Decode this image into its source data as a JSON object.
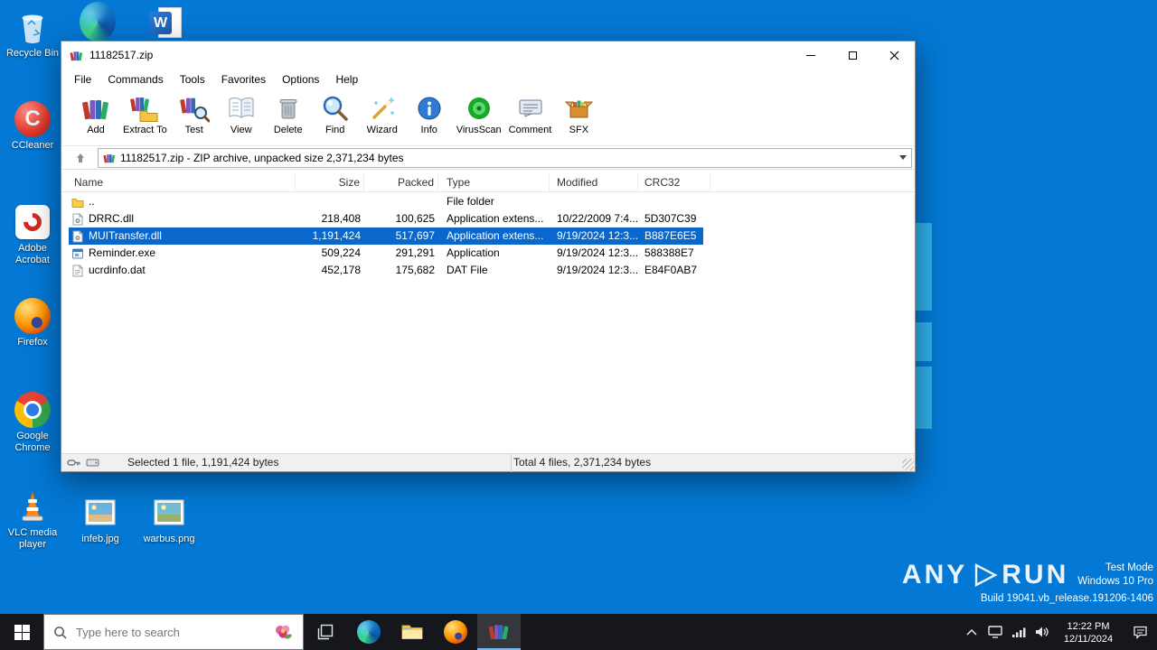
{
  "colors": {
    "desktop_bg": "#0378d4",
    "wallpaper_streak": "#2fb2ea",
    "selection_blue": "#0a68cd",
    "taskbar_bg": "#15171c"
  },
  "desktop": {
    "left_icons": [
      {
        "icon": "recycle-bin",
        "label": "Recycle Bin"
      },
      {
        "icon": "ccleaner",
        "label": "CCleaner"
      },
      {
        "icon": "adobe-acrobat",
        "label": "Adobe Acrobat"
      },
      {
        "icon": "firefox",
        "label": "Firefox"
      },
      {
        "icon": "google-chrome",
        "label": "Google Chrome"
      },
      {
        "icon": "vlc",
        "label": "VLC media player"
      }
    ],
    "top_icons": [
      {
        "icon": "microsoft-edge"
      },
      {
        "icon": "word-document"
      }
    ],
    "file_icons": [
      {
        "icon": "image-file",
        "label": "infeb.jpg"
      },
      {
        "icon": "image-file",
        "label": "warbus.png"
      }
    ],
    "watermark": {
      "brand_left": "ANY",
      "brand_right": "RUN",
      "line1": "Test Mode",
      "line2": "Windows 10 Pro",
      "line3": "Build 19041.vb_release.191206-1406"
    }
  },
  "window": {
    "title": "11182517.zip",
    "menu": [
      "File",
      "Commands",
      "Tools",
      "Favorites",
      "Options",
      "Help"
    ],
    "toolbar": [
      {
        "icon": "add-archive",
        "label": "Add"
      },
      {
        "icon": "extract-to",
        "label": "Extract To"
      },
      {
        "icon": "test-archive",
        "label": "Test"
      },
      {
        "icon": "view-file",
        "label": "View"
      },
      {
        "icon": "delete",
        "label": "Delete"
      },
      {
        "icon": "find",
        "label": "Find"
      },
      {
        "icon": "wizard",
        "label": "Wizard"
      },
      {
        "icon": "info",
        "label": "Info"
      },
      {
        "icon": "virus-scan",
        "label": "VirusScan"
      },
      {
        "icon": "comment",
        "label": "Comment"
      },
      {
        "icon": "sfx",
        "label": "SFX"
      }
    ],
    "address": "11182517.zip - ZIP archive, unpacked size 2,371,234 bytes",
    "columns": [
      "Name",
      "Size",
      "Packed",
      "Type",
      "Modified",
      "CRC32"
    ],
    "rows": [
      {
        "icon": "folder-up",
        "name": "..",
        "size": "",
        "packed": "",
        "type": "File folder",
        "modified": "",
        "crc": "",
        "selected": false
      },
      {
        "icon": "dll-file",
        "name": "DRRC.dll",
        "size": "218,408",
        "packed": "100,625",
        "type": "Application extens...",
        "modified": "10/22/2009 7:4...",
        "crc": "5D307C39",
        "selected": false
      },
      {
        "icon": "dll-file",
        "name": "MUITransfer.dll",
        "size": "1,191,424",
        "packed": "517,697",
        "type": "Application extens...",
        "modified": "9/19/2024 12:3...",
        "crc": "B887E6E5",
        "selected": true
      },
      {
        "icon": "exe-file",
        "name": "Reminder.exe",
        "size": "509,224",
        "packed": "291,291",
        "type": "Application",
        "modified": "9/19/2024 12:3...",
        "crc": "588388E7",
        "selected": false
      },
      {
        "icon": "dat-file",
        "name": "ucrdinfo.dat",
        "size": "452,178",
        "packed": "175,682",
        "type": "DAT File",
        "modified": "9/19/2024 12:3...",
        "crc": "E84F0AB7",
        "selected": false
      }
    ],
    "status": {
      "left": "Selected 1 file, 1,191,424 bytes",
      "right": "Total 4 files, 2,371,234 bytes"
    }
  },
  "taskbar": {
    "search_placeholder": "Type here to search",
    "clock": {
      "time": "12:22 PM",
      "date": "12/11/2024"
    }
  }
}
